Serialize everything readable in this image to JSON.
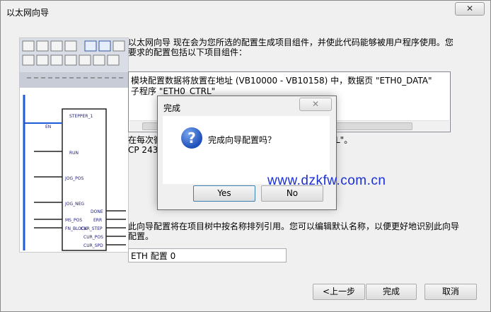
{
  "window": {
    "title": "以太网向导",
    "close_glyph": "✕"
  },
  "main": {
    "description": "以太网向导 现在会为您所选的配置生成项目组件，并使此代码能够被用户程序使用。您要求的配置包括以下项目组件：",
    "info_lines": [
      "模块配置数据将放置在地址 (VB10000 - VB10158) 中，数据页 \"ETH0_DATA\"",
      "子程序 \"ETH0_CTRL\""
    ],
    "note_fragment_1": "在每次循",
    "note_fragment_1_end": "L\"。",
    "note_fragment_2": "CP 243-1",
    "naming_note": "此向导配置将在项目树中按名称排列引用。您可以编辑默认名称，以便更好地识别此向导配置。",
    "config_name_value": "ETH 配置 0"
  },
  "illustration": {
    "block_title": "STEPPER_1",
    "pins_left": [
      "EN",
      "RUN",
      "JOG_POS",
      "JOG_NEG",
      "MS_POS",
      "FN_BLOCK"
    ],
    "pins_right": [
      "DONE",
      "ERR",
      "CUR_STEP",
      "CUR_POS",
      "CUR_SPD"
    ]
  },
  "dialog": {
    "title": "完成",
    "message": "完成向导配置吗？",
    "icon_glyph": "?",
    "yes_label": "Yes",
    "no_label": "No"
  },
  "footer": {
    "prev_label": "<上一步",
    "finish_label": "完成",
    "cancel_label": "取消"
  },
  "watermark": "www.dzkfw.com.cn",
  "colors": {
    "watermark": "#1a2fd4",
    "ladder_rail": "#1e5bd8",
    "icon_blue": "#1d4fb8"
  }
}
